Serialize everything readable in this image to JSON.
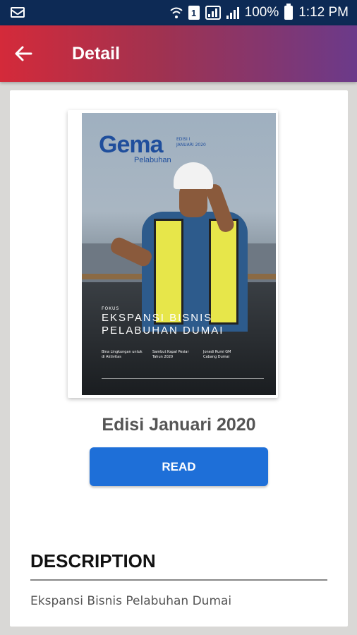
{
  "status_bar": {
    "battery_text": "100%",
    "time": "1:12 PM",
    "sim_label": "1",
    "icons": [
      "mail-icon",
      "wifi-icon",
      "sim-icon",
      "signal-icon",
      "signal-icon",
      "battery-icon"
    ]
  },
  "app_bar": {
    "title": "Detail",
    "back_icon": "arrow-left-icon",
    "colors": {
      "start": "#d42a3a",
      "end": "#6b3a8a"
    }
  },
  "magazine": {
    "cover": {
      "logo": "Gema",
      "logo_sub": "Pelabuhan",
      "fokus": "FOKUS",
      "headline": "EKSPANSI BISNIS PELABUHAN DUMAI"
    },
    "edition_title": "Edisi Januari 2020",
    "read_label": "READ",
    "read_color": "#1e6fd8"
  },
  "description": {
    "heading": "DESCRIPTION",
    "text": "Ekspansi Bisnis Pelabuhan Dumai"
  }
}
